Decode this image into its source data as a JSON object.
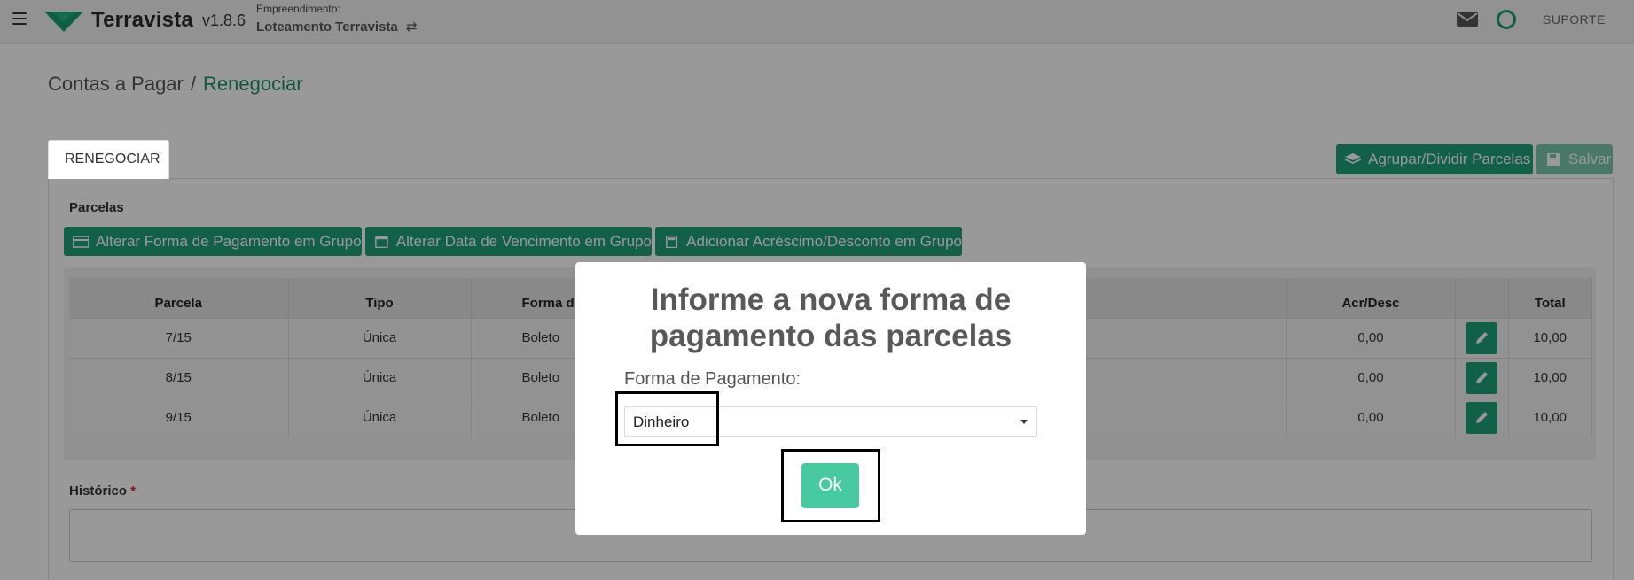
{
  "header": {
    "brand": "Terravista",
    "version": "v1.8.6",
    "empreendimento_label": "Empreendimento:",
    "empreendimento_value": "Loteamento Terravista",
    "support": "SUPORTE",
    "accent": "#1d9d75"
  },
  "breadcrumb": {
    "parent": "Contas a Pagar",
    "separator": "/",
    "current": "Renegociar"
  },
  "tab": {
    "label": "RENEGOCIAR"
  },
  "actions": {
    "agrupar_label": "Agrupar/Dividir Parcelas",
    "salvar_label": "Salvar"
  },
  "parcelas": {
    "label": "Parcelas",
    "group_buttons": [
      "Alterar Forma de Pagamento em Grupo",
      "Alterar Data de Vencimento em Grupo",
      "Adicionar Acréscimo/Desconto em Grupo"
    ],
    "columns": [
      "Parcela",
      "Tipo",
      "Forma de",
      "Acr/Desc",
      "Total"
    ],
    "rows": [
      {
        "parcela": "7/15",
        "tipo": "Única",
        "forma": "Boleto",
        "acr": "0,00",
        "total": "10,00"
      },
      {
        "parcela": "8/15",
        "tipo": "Única",
        "forma": "Boleto",
        "acr": "0,00",
        "total": "10,00"
      },
      {
        "parcela": "9/15",
        "tipo": "Única",
        "forma": "Boleto",
        "acr": "0,00",
        "total": "10,00"
      }
    ]
  },
  "historico": {
    "label": "Histórico",
    "required_mark": "*"
  },
  "modal": {
    "title": "Informe a nova forma de pagamento das parcelas",
    "field_label": "Forma de Pagamento:",
    "select_value": "Dinheiro",
    "ok_label": "Ok",
    "ok_color": "#48c9a0"
  }
}
